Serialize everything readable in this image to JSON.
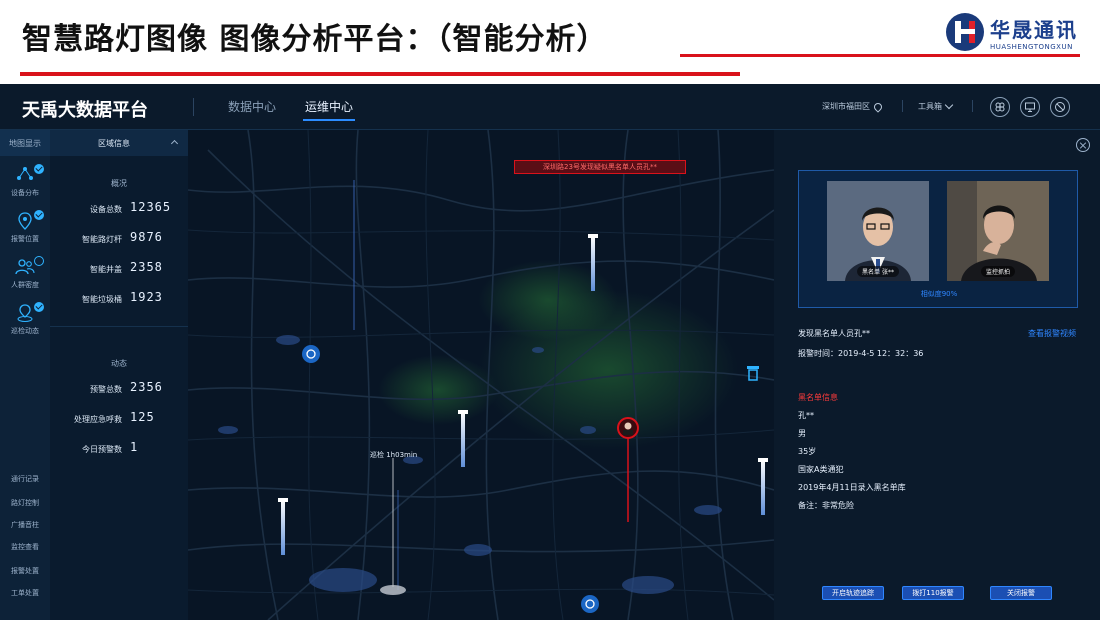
{
  "slide": {
    "title": "智慧路灯图像 图像分析平台：（智能分析）",
    "logo_cn": "华晟通讯",
    "logo_en": "HUASHENGTONGXUN"
  },
  "app": {
    "title": "天禹大数据平台",
    "nav": [
      "数据中心",
      "运维中心"
    ],
    "active_nav": "运维中心",
    "location": "深圳市福田区",
    "toolbox": "工具箱"
  },
  "rail": {
    "header": "地图显示",
    "items": [
      {
        "label": "设备分布",
        "icon": "device-distribution-icon",
        "checked": true
      },
      {
        "label": "报警位置",
        "icon": "alarm-location-icon",
        "checked": true
      },
      {
        "label": "人群密度",
        "icon": "crowd-density-icon",
        "checked": false
      },
      {
        "label": "巡检动态",
        "icon": "patrol-dynamic-icon",
        "checked": true
      }
    ],
    "links": [
      "通行记录",
      "路灯控制",
      "广播音柱",
      "监控查看",
      "报警处置",
      "工单处置"
    ]
  },
  "region": {
    "title": "区域信息",
    "overview_title": "概况",
    "overview": [
      {
        "label": "设备总数",
        "value": "12365"
      },
      {
        "label": "智能路灯杆",
        "value": "9876"
      },
      {
        "label": "智能井盖",
        "value": "2358"
      },
      {
        "label": "智能垃圾桶",
        "value": "1923"
      }
    ],
    "dynamic_title": "动态",
    "dynamic": [
      {
        "label": "预警总数",
        "value": "2356"
      },
      {
        "label": "处理应急呼救",
        "value": "125"
      },
      {
        "label": "今日预警数",
        "value": "1"
      }
    ]
  },
  "map": {
    "alert": "深圳路23号发现疑似黑名单人员孔**",
    "patrol_label": "巡检 1h03min",
    "accent": "#2fb3ff",
    "alarm_color": "#d9121b"
  },
  "detail": {
    "face_left_tag": "黑名单 张**",
    "face_right_tag": "监控抓拍",
    "similarity": "相似度90%",
    "event_title": "发现黑名单人员孔**",
    "view_video": "查看报警视频",
    "event_time": "报警时间：2019-4-5 12：32：36",
    "info_title": "黑名单信息",
    "info": [
      "孔**",
      "男",
      "35岁",
      "国家A类通犯",
      "2019年4月11日录入黑名单库",
      "备注：非常危险"
    ],
    "buttons": [
      "开启轨迹追踪",
      "拨打110报警",
      "关闭报警"
    ]
  }
}
